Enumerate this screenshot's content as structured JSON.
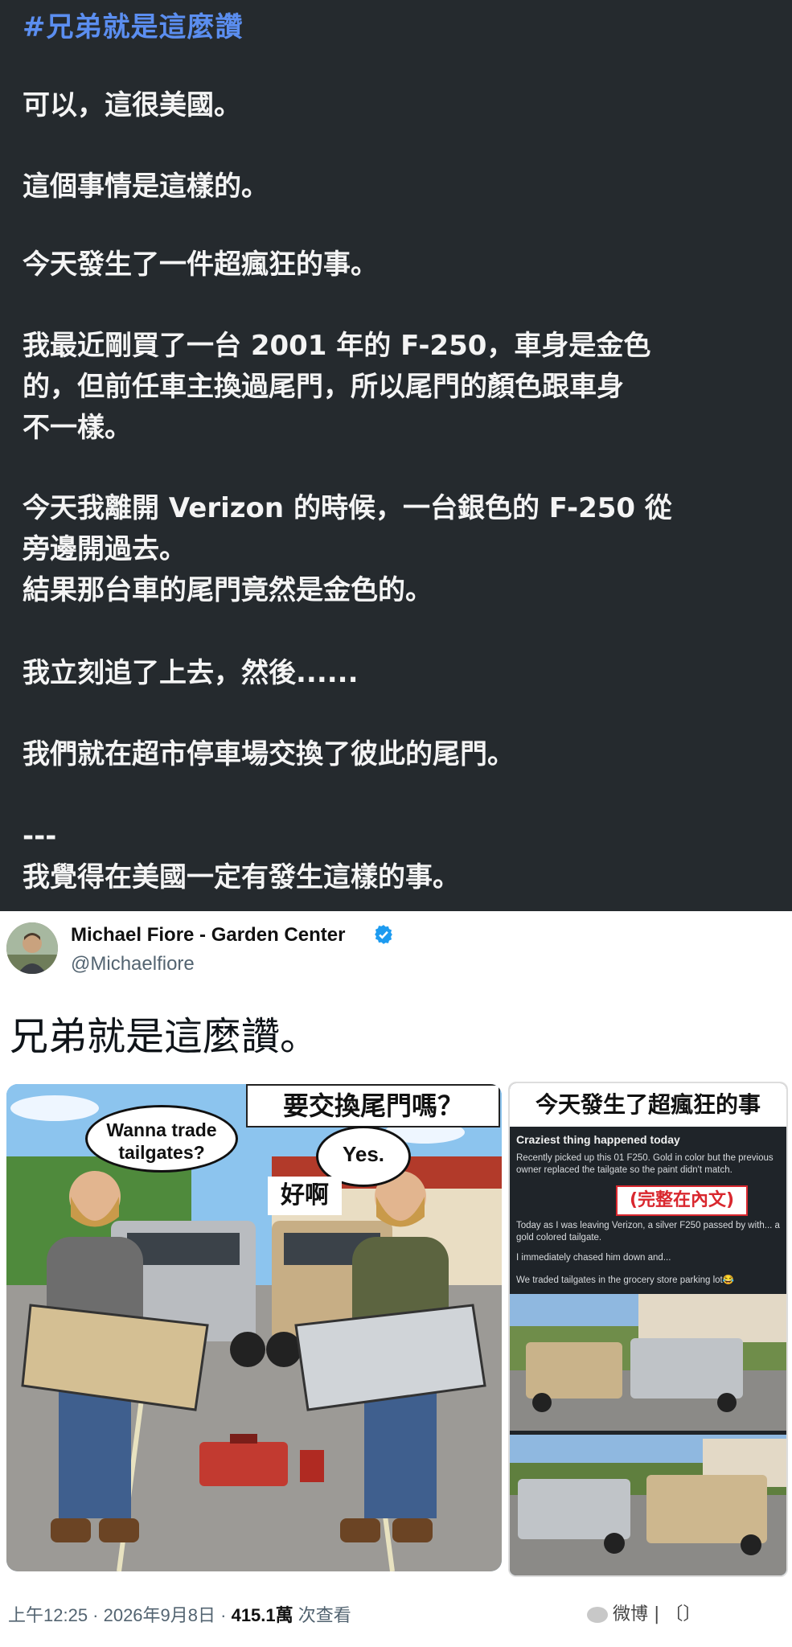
{
  "post": {
    "hashtag": "#兄弟就是這麼讚",
    "paragraphs": [
      "可以，這很美國。",
      "這個事情是這樣的。",
      "今天發生了一件超瘋狂的事。",
      "我最近剛買了一台 2001 年的 F-250，車身是金色\n的，但前任車主換過尾門，所以尾門的顏色跟車身\n不一樣。",
      "今天我離開 Verizon 的時候，一台銀色的 F-250 從\n旁邊開過去。\n結果那台車的尾門竟然是金色的。",
      "我立刻追了上去，然後......",
      "我們就在超市停車場交換了彼此的尾門。",
      "---\n我覺得在美國一定有發生這樣的事。"
    ]
  },
  "tweet": {
    "author_name": "Michael Fiore - Garden Center",
    "handle": "@Michaelfiore",
    "text": "兄弟就是這麼讚。",
    "left_image": {
      "caption_top": "要交換尾門嗎？",
      "bubble_left": "Wanna trade\ntailgates?",
      "bubble_right": "Yes.",
      "caption_mid": "好啊"
    },
    "right_image": {
      "header": "今天發生了超瘋狂的事",
      "title": "Craziest thing happened today",
      "line1": "Recently picked up this 01 F250. Gold in color but the previous owner replaced the tailgate so the paint didn't match.",
      "stamp": "(完整在內文)",
      "line2": "Today as I was leaving Verizon, a silver F250 passed by with... a gold colored tailgate.",
      "line3": "I immediately chased him down and...",
      "line4": "We traded tailgates in the grocery store parking lot😂"
    },
    "meta": {
      "time_date": "上午12:25 · 2026年9月8日 · ",
      "views": "415.1萬",
      "views_label": " 次查看"
    },
    "watermark": "微博 | 〔〕"
  },
  "colors": {
    "dark_bg": "#252a2e",
    "hashtag": "#5b8ef0",
    "verified": "#1d9bf0",
    "stamp": "#d9272e"
  }
}
